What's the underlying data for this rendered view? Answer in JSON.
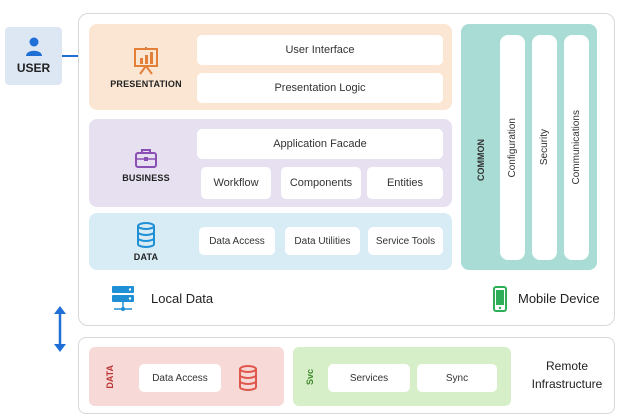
{
  "user": {
    "label": "USER",
    "color": "#1f6fd6"
  },
  "presentation": {
    "label": "PRESENTATION",
    "icon": "presentation-board-icon",
    "boxes": [
      "User Interface",
      "Presentation Logic"
    ]
  },
  "business": {
    "label": "BUSINESS",
    "icon": "briefcase-icon",
    "facade": "Application Facade",
    "boxes": [
      "Workflow",
      "Components",
      "Entities"
    ]
  },
  "data": {
    "label": "DATA",
    "icon": "database-icon",
    "boxes": [
      "Data Access",
      "Data Utilities",
      "Service Tools"
    ]
  },
  "common": {
    "label": "COMMON",
    "items": [
      "Configuration",
      "Security",
      "Communications"
    ]
  },
  "local_data": {
    "label": "Local Data",
    "icon": "server-icon"
  },
  "mobile_device": {
    "label": "Mobile Device",
    "icon": "mobile-phone-icon"
  },
  "remote": {
    "data_label": "DATA",
    "data_access": "Data Access",
    "svc_label": "Svc",
    "services": "Services",
    "sync": "Sync",
    "title_line1": "Remote",
    "title_line2": "Infrastructure"
  },
  "colors": {
    "presentation_bg": "#fbe6d3",
    "business_bg": "#e6e0f1",
    "data_bg": "#d8ecf5",
    "common_bg": "#a8dcd4",
    "remote_data_bg": "#f7d9d7",
    "remote_svc_bg": "#d6efc9",
    "accent_blue": "#1f6fd6"
  }
}
